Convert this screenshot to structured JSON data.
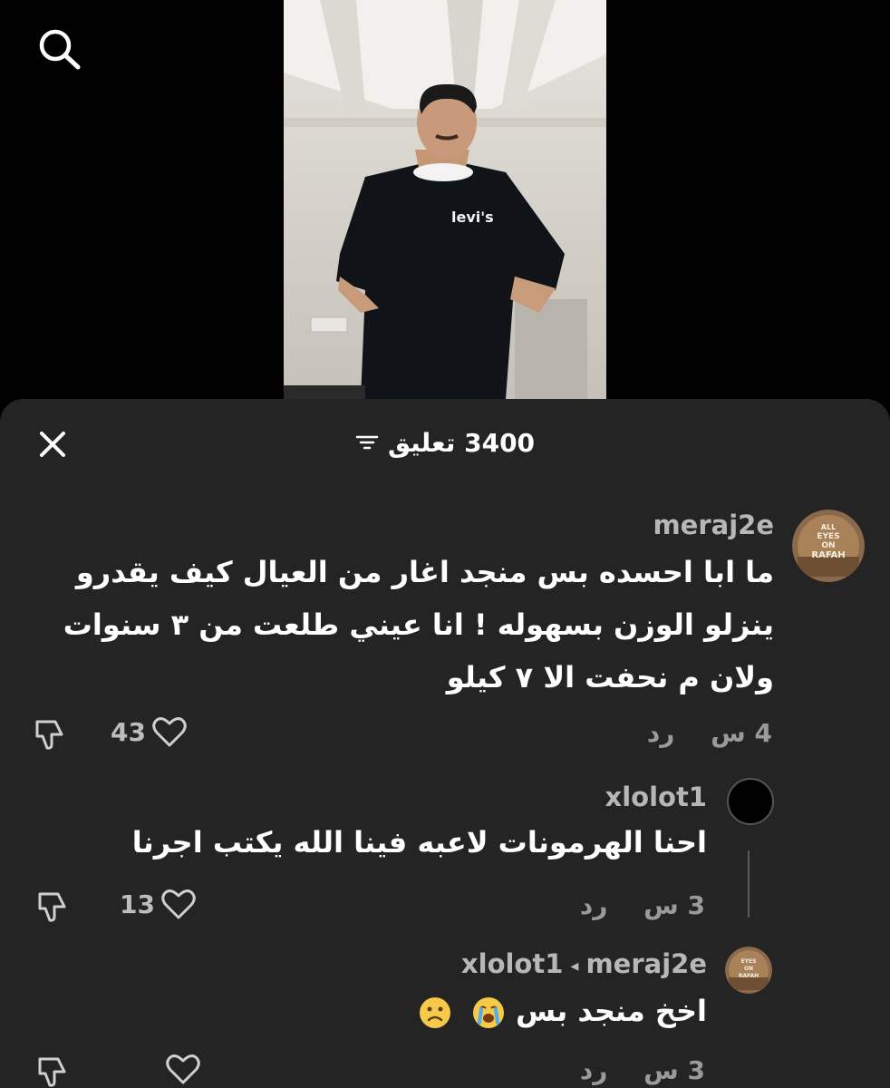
{
  "video": {
    "shirt_brand": "levi's"
  },
  "comments_sheet": {
    "count_label": "3400 تعليق",
    "comments": [
      {
        "username": "meraj2e",
        "text": "ما ابا احسده بس منجد اغار من العيال كيف يقدرو ينزلو الوزن بسهوله ! انا عيني طلعت من ٣ سنوات ولان م نحفت الا ٧ كيلو",
        "time": "4 س",
        "reply_label": "رد",
        "likes": "43"
      },
      {
        "username": "xlolot1",
        "text": "احنا الهرمونات لاعبه فينا الله يكتب اجرنا",
        "time": "3 س",
        "reply_label": "رد",
        "likes": "13"
      },
      {
        "username": "xlolot1",
        "reply_to": "meraj2e",
        "text": "اخخ منجد بس",
        "time": "3 س",
        "reply_label": "رد",
        "likes": ""
      }
    ],
    "avatar_text": [
      "ALL",
      "EYES",
      "ON",
      "RAFAH"
    ]
  },
  "colors": {
    "sheet_bg": "#242424",
    "muted_text": "#9a9a9a",
    "username": "#b7b7b7"
  }
}
